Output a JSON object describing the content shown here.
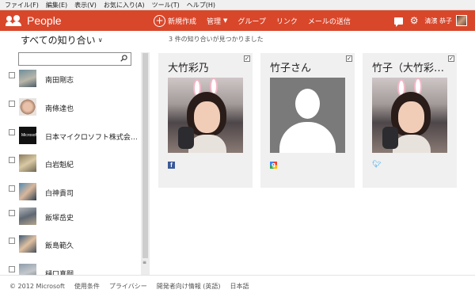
{
  "menu": [
    "ファイル(F)",
    "編集(E)",
    "表示(V)",
    "お気に入り(A)",
    "ツール(T)",
    "ヘルプ(H)"
  ],
  "app": {
    "title": "People",
    "accent": "#d9472b"
  },
  "nav": {
    "new": "新規作成",
    "manage": "管理",
    "groups": "グループ",
    "link": "リンク",
    "send_mail": "メールの送信"
  },
  "user": {
    "name": "清濱 恭子"
  },
  "filter": {
    "label": "すべての知り合い"
  },
  "search": {
    "placeholder": "",
    "value": ""
  },
  "contacts": [
    {
      "name": "南田剛志"
    },
    {
      "name": "南條達也"
    },
    {
      "name": "日本マイクロソフト株式会…",
      "logo_text": "Microsoft"
    },
    {
      "name": "白岩魁紀"
    },
    {
      "name": "白神貴司"
    },
    {
      "name": "飯塚岳史"
    },
    {
      "name": "飯島範久"
    },
    {
      "name": "樋口真嗣"
    }
  ],
  "results": {
    "found_text": "3 件の知り合いが見つかりました"
  },
  "cards": [
    {
      "name": "大竹彩乃",
      "source": "facebook-icon",
      "photo": "user-photo",
      "checked": true
    },
    {
      "name": "竹子さん",
      "source": "google-icon",
      "photo": "default-avatar",
      "checked": true
    },
    {
      "name": "竹子（大竹彩…",
      "source": "twitter-icon",
      "photo": "user-photo",
      "checked": true
    }
  ],
  "footer": [
    "© 2012 Microsoft",
    "使用条件",
    "プライバシー",
    "開発者向け情報 (英語)",
    "日本語"
  ]
}
